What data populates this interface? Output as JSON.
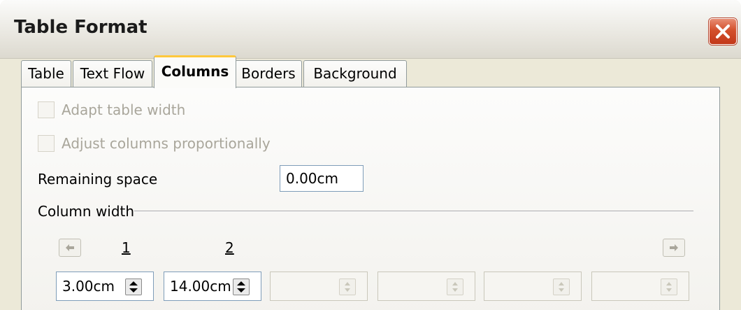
{
  "window": {
    "title": "Table Format"
  },
  "tabs": [
    {
      "label": "Table",
      "active": false
    },
    {
      "label": "Text Flow",
      "active": false
    },
    {
      "label": "Columns",
      "active": true
    },
    {
      "label": "Borders",
      "active": false
    },
    {
      "label": "Background",
      "active": false
    }
  ],
  "options": {
    "adapt_table_width": {
      "label": "Adapt table width",
      "checked": false,
      "enabled": false
    },
    "adjust_columns": {
      "label": "Adjust columns proportionally",
      "checked": false,
      "enabled": false
    }
  },
  "remaining_space": {
    "label": "Remaining space",
    "value": "0.00cm"
  },
  "column_width": {
    "label": "Column width",
    "column_numbers": [
      "1",
      "2"
    ],
    "fields": [
      {
        "value": "3.00cm",
        "enabled": true
      },
      {
        "value": "14.00cm",
        "enabled": true
      },
      {
        "value": "",
        "enabled": false
      },
      {
        "value": "",
        "enabled": false
      },
      {
        "value": "",
        "enabled": false
      },
      {
        "value": "",
        "enabled": false
      }
    ]
  },
  "icons": {
    "close": "close-icon",
    "left": "arrow-left-icon",
    "right": "arrow-right-icon",
    "spinner": "spinner-icon"
  },
  "colors": {
    "active_tab_accent": "#ffc83c",
    "close_button": "#d3502c"
  }
}
